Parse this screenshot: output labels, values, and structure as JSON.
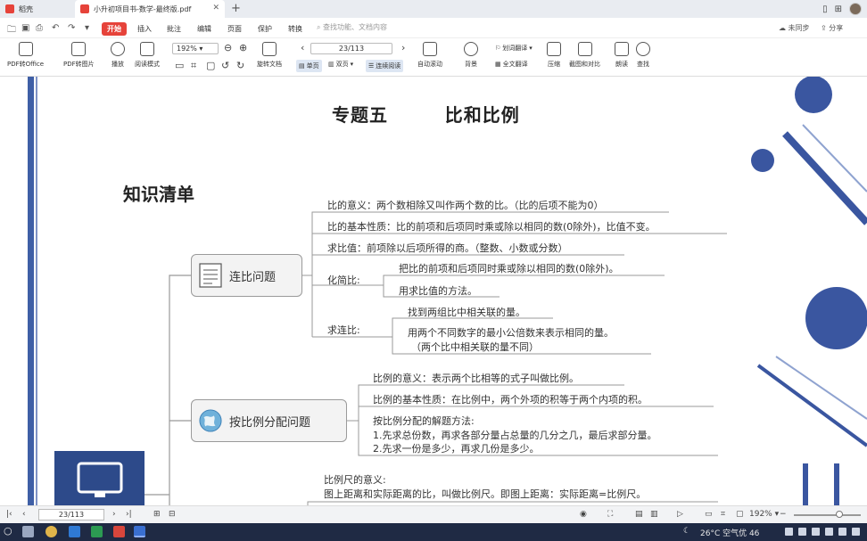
{
  "tabs": {
    "home": "稻壳",
    "document": "小升初项目书-数学-最终版.pdf"
  },
  "menu": {
    "start": "开始",
    "items": [
      "插入",
      "批注",
      "编辑",
      "页面",
      "保护",
      "转换"
    ],
    "search_placeholder": "查找功能、文档内容",
    "unsync": "未同步",
    "share": "分享"
  },
  "ribbon": {
    "pdf_to_office": "PDF转Office",
    "pdf_to_image": "PDF转图片",
    "play": "播放",
    "read_mode": "阅读模式",
    "zoom": "192%",
    "page": "23/113",
    "rotate": "旋转文档",
    "single": "单页",
    "double": "双页",
    "continuous": "连续阅读",
    "auto_scroll": "自动滚动",
    "background": "背景",
    "translate": "划词翻译",
    "full_translate": "全文翻译",
    "compress": "压缩",
    "screenshot": "截图和对比",
    "read_aloud": "朗读",
    "find": "查找"
  },
  "document": {
    "title": "专题五        比和比例",
    "knowledge_title": "知识清单",
    "nodes": {
      "lianbi": "连比问题",
      "anbili": "按比例分配问题"
    },
    "leaves": {
      "l1": "比的意义：两个数相除又叫作两个数的比。（比的后项不能为0）",
      "l2": "比的基本性质：比的前项和后项同时乘或除以相同的数(0除外)，比值不变。",
      "l3": "求比值：前项除以后项所得的商。（整数、小数或分数）",
      "l4": "化简比:",
      "l4a": "把比的前项和后项同时乘或除以相同的数(0除外)。",
      "l4b": "用求比值的方法。",
      "l5": "求连比:",
      "l5a": "找到两组比中相关联的量。",
      "l5b": "用两个不同数字的最小公倍数来表示相同的量。",
      "l5c": "（两个比中相关联的量不同）",
      "m1": "比例的意义：表示两个比相等的式子叫做比例。",
      "m2": "比例的基本性质：在比例中，两个外项的积等于两个内项的积。",
      "m3": "按比例分配的解题方法:",
      "m3a": "1.先求总份数，再求各部分量占总量的几分之几，最后求部分量。",
      "m3b": "2.先求一份是多少，再求几份是多少。",
      "s1": "比例尺的意义:",
      "s2": "图上距离和实际距离的比，叫做比例尺。即图上距离：实际距离=比例尺。"
    }
  },
  "status": {
    "page": "23/113",
    "zoom": "192%"
  },
  "taskbar": {
    "weather": "26°C 空气优 46"
  },
  "colors": {
    "accent": "#e6433a",
    "brand_blue": "#3f5fa6",
    "dark_blue": "#2d4a8a"
  }
}
